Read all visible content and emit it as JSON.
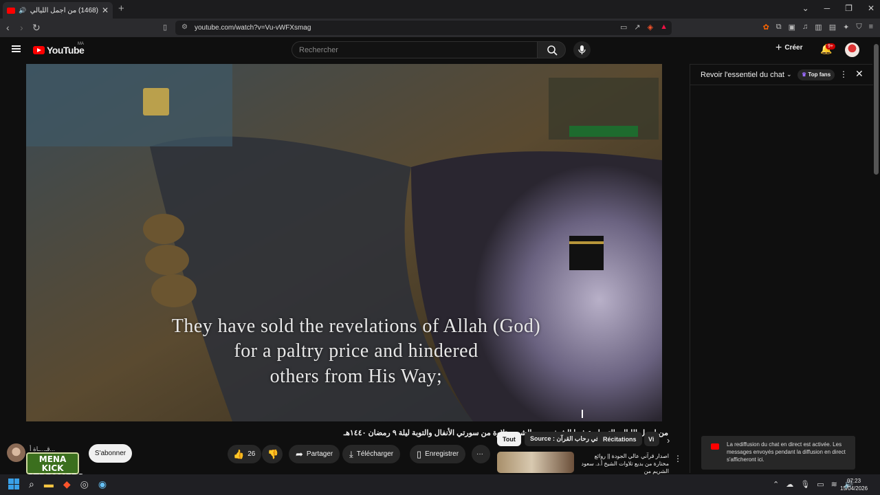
{
  "browser": {
    "tab_title": "(1468) من اجمل الليالي التي ا...",
    "tab_close": "✕",
    "new_tab": "+",
    "url": "youtube.com/watch?v=Vu-vWFXsmag"
  },
  "youtube": {
    "logo_text": "YouTube",
    "country_code": "MA",
    "search_placeholder": "Rechercher",
    "create_label": "Créer",
    "notification_count": "9+"
  },
  "video": {
    "subtitle_line1": "They have sold the revelations of Allah (God)",
    "subtitle_line2": "for a paltry price and hindered",
    "subtitle_line3": "others from His Way;",
    "title": "من اجمل الليالي التي ابدع فيها الشيخ سعود الشريم تلاوة من سورتي الأنفال والتوبة ليلة ٩ رمضان ١٤٤٠هـ",
    "channel_name": "قـ...ـاة أ...",
    "overlay_badge": "MENA KICK STREAMERS",
    "subscribe_label": "S'abonner",
    "like_count": "26",
    "share_label": "Partager",
    "download_label": "Télécharger",
    "save_label": "Enregistrer",
    "more_label": "···"
  },
  "chips": [
    {
      "label": "Tout"
    },
    {
      "label": "Source : في رحاب القرآن"
    },
    {
      "label": "Récitations"
    },
    {
      "label": "Vi"
    }
  ],
  "recommendation": {
    "title": "اصدار قرآني عالي الجودة || روائع مختارة من بديع تلاوات الشيخ أ.د. سعود الشريم من"
  },
  "chat": {
    "header_label": "Revoir l'essentiel du chat",
    "top_fans_label": "Top fans",
    "notice": "La rediffusion du chat en direct est activée. Les messages envoyés pendant la diffusion en direct s'afficheront ici."
  },
  "taskbar": {
    "time": "07:23",
    "date": "15/04/2026"
  },
  "colors": {
    "youtube_red": "#ff0000",
    "background": "#0f0f0f",
    "chip_bg": "#272727"
  }
}
